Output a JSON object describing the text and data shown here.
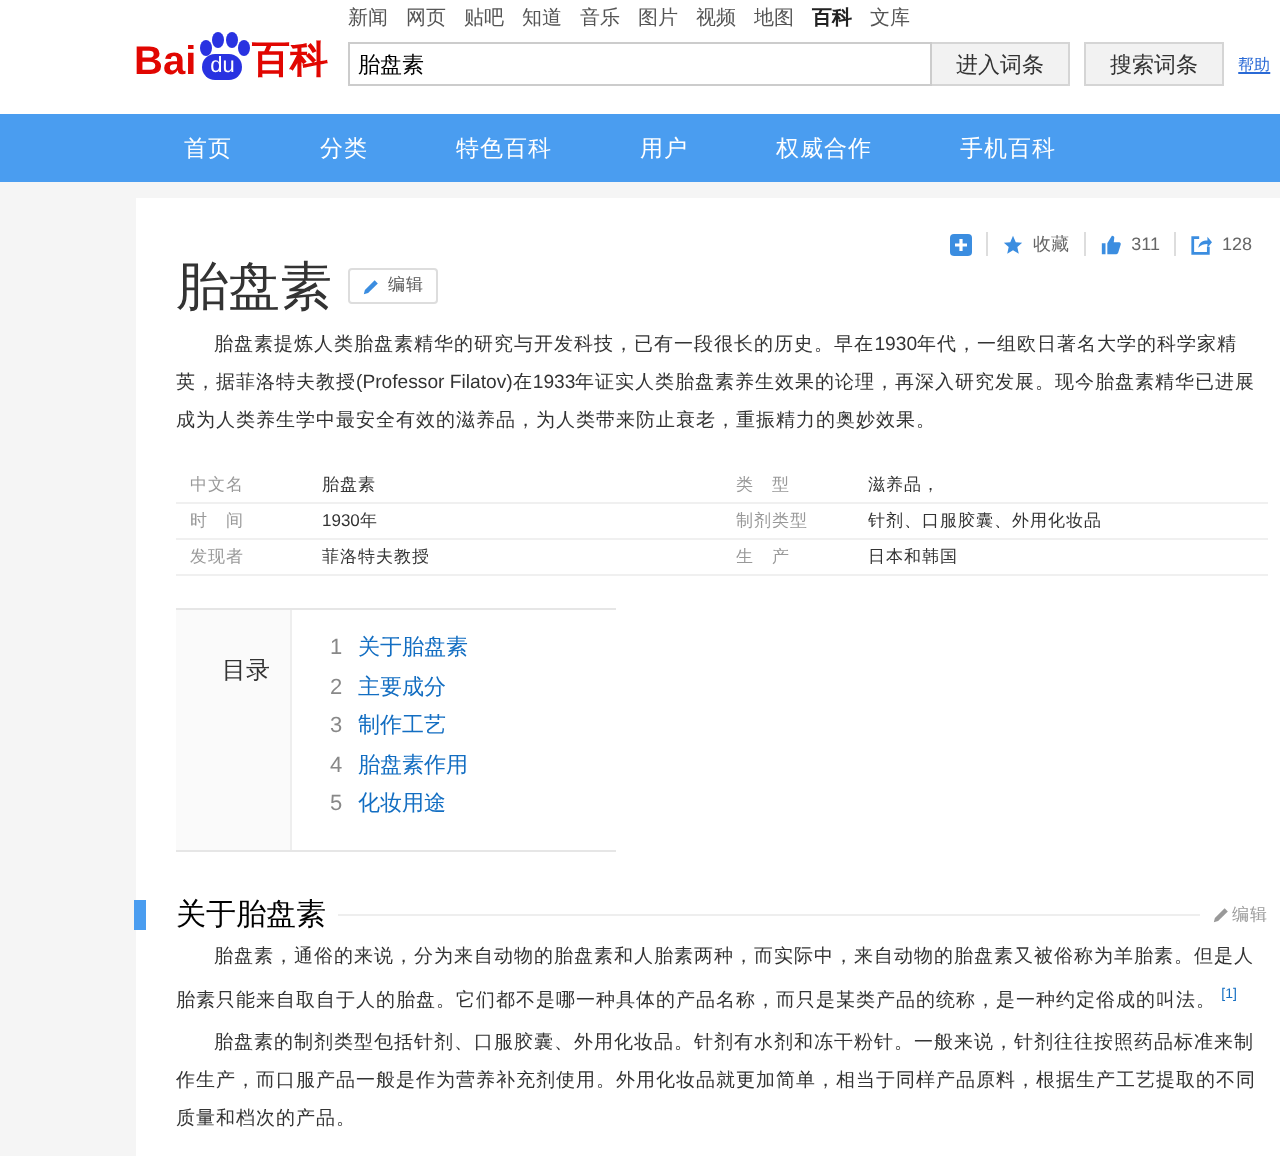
{
  "header": {
    "logo": {
      "latin": "Bai",
      "paw": "du",
      "cjk": "百科"
    },
    "top_links": [
      {
        "label": "新闻",
        "selected": false
      },
      {
        "label": "网页",
        "selected": false
      },
      {
        "label": "贴吧",
        "selected": false
      },
      {
        "label": "知道",
        "selected": false
      },
      {
        "label": "音乐",
        "selected": false
      },
      {
        "label": "图片",
        "selected": false
      },
      {
        "label": "视频",
        "selected": false
      },
      {
        "label": "地图",
        "selected": false
      },
      {
        "label": "百科",
        "selected": true
      },
      {
        "label": "文库",
        "selected": false
      }
    ],
    "search": {
      "value": "胎盘素"
    },
    "buttons": [
      "进入词条",
      "搜索词条"
    ],
    "help_link": "帮助"
  },
  "nav": [
    "首页",
    "分类",
    "特色百科",
    "用户",
    "权威合作",
    "手机百科"
  ],
  "article": {
    "tools": {
      "collect": "收藏",
      "likes": "311",
      "shares": "128"
    },
    "title": "胎盘素",
    "edit_button": "编辑",
    "summary": "胎盘素提炼人类胎盘素精华的研究与开发科技，已有一段很长的历史。早在1930年代，一组欧日著名大学的科学家精英，据菲洛特夫教授(Professor Filatov)在1933年证实人类胎盘素养生效果的论理，再深入研究发展。现今胎盘素精华已进展成为人类养生学中最安全有效的滋养品，为人类带来防止衰老，重振精力的奥妙效果。",
    "infobox": [
      {
        "label": "中文名",
        "value": "胎盘素"
      },
      {
        "label": "类　型",
        "value": "滋养品，"
      },
      {
        "label": "时　间",
        "value": "1930年"
      },
      {
        "label": "制剂类型",
        "value": "针剂、口服胶囊、外用化妆品"
      },
      {
        "label": "发现者",
        "value": "菲洛特夫教授"
      },
      {
        "label": "生　产",
        "value": "日本和韩国"
      }
    ],
    "toc": {
      "title": "目录",
      "items": [
        {
          "number": "1",
          "label": "关于胎盘素"
        },
        {
          "number": "2",
          "label": "主要成分"
        },
        {
          "number": "3",
          "label": "制作工艺"
        },
        {
          "number": "4",
          "label": "胎盘素作用"
        },
        {
          "number": "5",
          "label": "化妆用途"
        }
      ]
    },
    "section": {
      "title": "关于胎盘素",
      "edit_link": "编辑",
      "paragraphs": [
        "胎盘素，通俗的来说，分为来自动物的胎盘素和人胎素两种，而实际中，来自动物的胎盘素又被俗称为羊胎素。但是人胎素只能来自取自于人的胎盘。它们都不是哪一种具体的产品名称，而只是某类产品的统称，是一种约定俗成的叫法。 $^{[1]}$",
        "胎盘素的制剂类型包括针剂、口服胶囊、外用化妆品。针剂有水剂和冻干粉针。一般来说，针剂往往按照药品标准来制作生产，而口服产品一般是作为营养补充剂使用。外用化妆品就更加简单，相当于同样产品原料，根据生产工艺提取的不同质量和档次的产品。"
      ]
    }
  }
}
